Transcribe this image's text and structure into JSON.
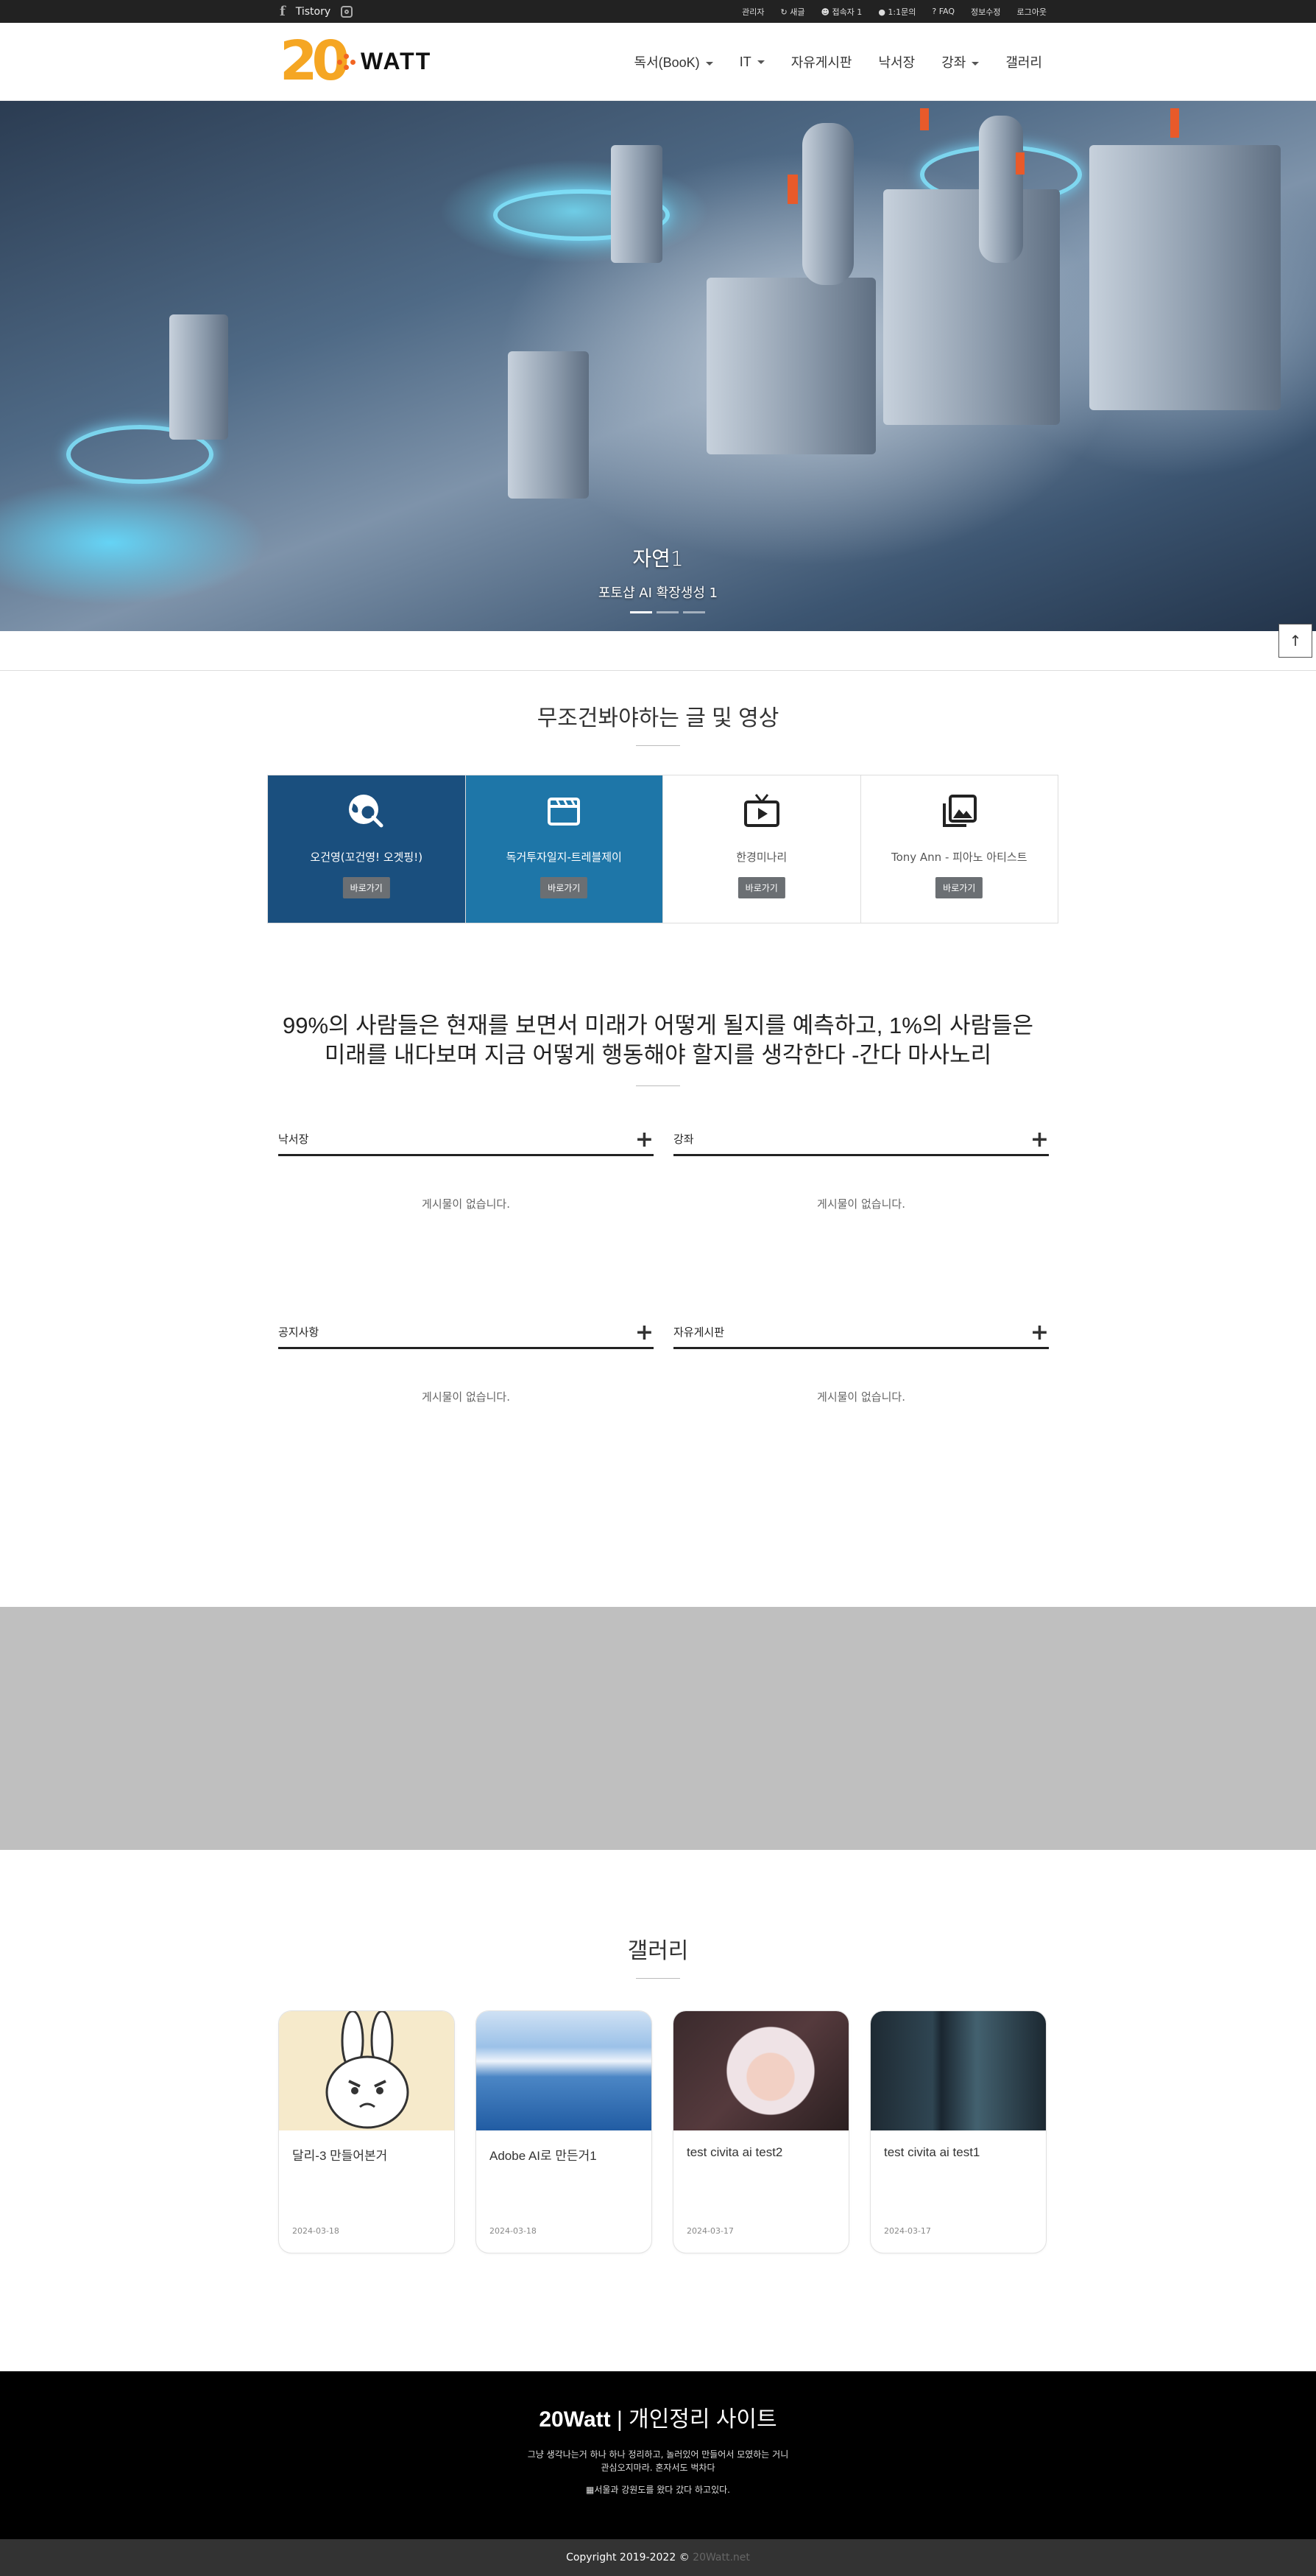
{
  "topbar": {
    "tistory": "Tistory",
    "links": [
      "관리자",
      "새글",
      "접속자 1",
      "1:1문의",
      "FAQ",
      "정보수정",
      "로그아웃"
    ]
  },
  "header": {
    "logo_number": "20",
    "logo_text": "WATT",
    "nav": [
      "독서(BooK)",
      "IT",
      "자유게시판",
      "낙서장",
      "강좌",
      "갤러리"
    ]
  },
  "hero": {
    "title": "자연1",
    "subtitle": "포토샵 AI 확장생성 1"
  },
  "featured": {
    "title": "무조건봐야하는 글 및 영상",
    "cards": [
      {
        "label": "오건영(꼬건영! 오겟핑!)",
        "button": "바로가기",
        "icon": "search-globe-icon"
      },
      {
        "label": "독거투자일지-트레블제이",
        "button": "바로가기",
        "icon": "clapperboard-icon"
      },
      {
        "label": "한경미나리",
        "button": "바로가기",
        "icon": "tv-play-icon"
      },
      {
        "label": "Tony Ann - 피아노 아티스트",
        "button": "바로가기",
        "icon": "image-gallery-icon"
      }
    ]
  },
  "quote": {
    "line1": "99%의 사람들은 현재를 보면서 미래가 어떻게 될지를 예측하고, 1%의 사람들은",
    "line2": "미래를 내다보며 지금 어떻게 행동해야 할지를 생각한다 -간다 마사노리"
  },
  "boards": [
    {
      "name": "낙서장",
      "empty": "게시물이 없습니다."
    },
    {
      "name": "강좌",
      "empty": "게시물이 없습니다."
    },
    {
      "name": "공지사항",
      "empty": "게시물이 없습니다."
    },
    {
      "name": "자유게시판",
      "empty": "게시물이 없습니다."
    }
  ],
  "gallery": {
    "title": "갤러리",
    "items": [
      {
        "title": "달리-3 만들어본거",
        "date": "2024-03-18"
      },
      {
        "title": "Adobe AI로 만든거1",
        "date": "2024-03-18"
      },
      {
        "title": "test civita ai test2",
        "date": "2024-03-17"
      },
      {
        "title": "test civita ai test1",
        "date": "2024-03-17"
      }
    ]
  },
  "footer": {
    "title_bold": "20Watt",
    "title_rest": " | 개인정리 사이트",
    "desc1": "그냥 생각나는거 하나 하나 정리하고, 놀러있어 만들어서 모였하는 거니",
    "desc2": "관심오지마라. 혼자서도 벅차다",
    "desc3": "▦서울과 강원도를 왔다 갔다 하고있다.",
    "copyright": "Copyright 2019-2022 ©",
    "copyright_link": "20Watt.net"
  }
}
